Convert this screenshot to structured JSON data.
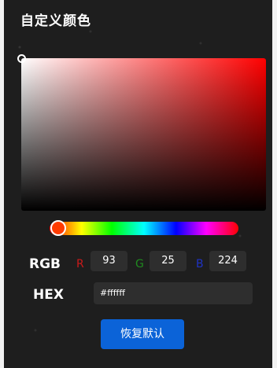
{
  "title": "自定义颜色",
  "rgb": {
    "label": "RGB",
    "r": {
      "label": "R",
      "value": "93",
      "color": "#cc1a1a"
    },
    "g": {
      "label": "G",
      "value": "25",
      "color": "#1f8a1f"
    },
    "b": {
      "label": "B",
      "value": "224",
      "color": "#1f33c4"
    }
  },
  "hex": {
    "label": "HEX",
    "value": "#ffffff"
  },
  "reset_button": "恢复默认",
  "colors": {
    "panel_bg": "#1e1e1e",
    "field_bg": "#2e2e2e",
    "button_bg": "#0b63d8",
    "hue_handle": "#ff3b00"
  },
  "icons": {
    "sv_cursor": "ring-icon",
    "hue_cursor": "circle-handle-icon"
  }
}
